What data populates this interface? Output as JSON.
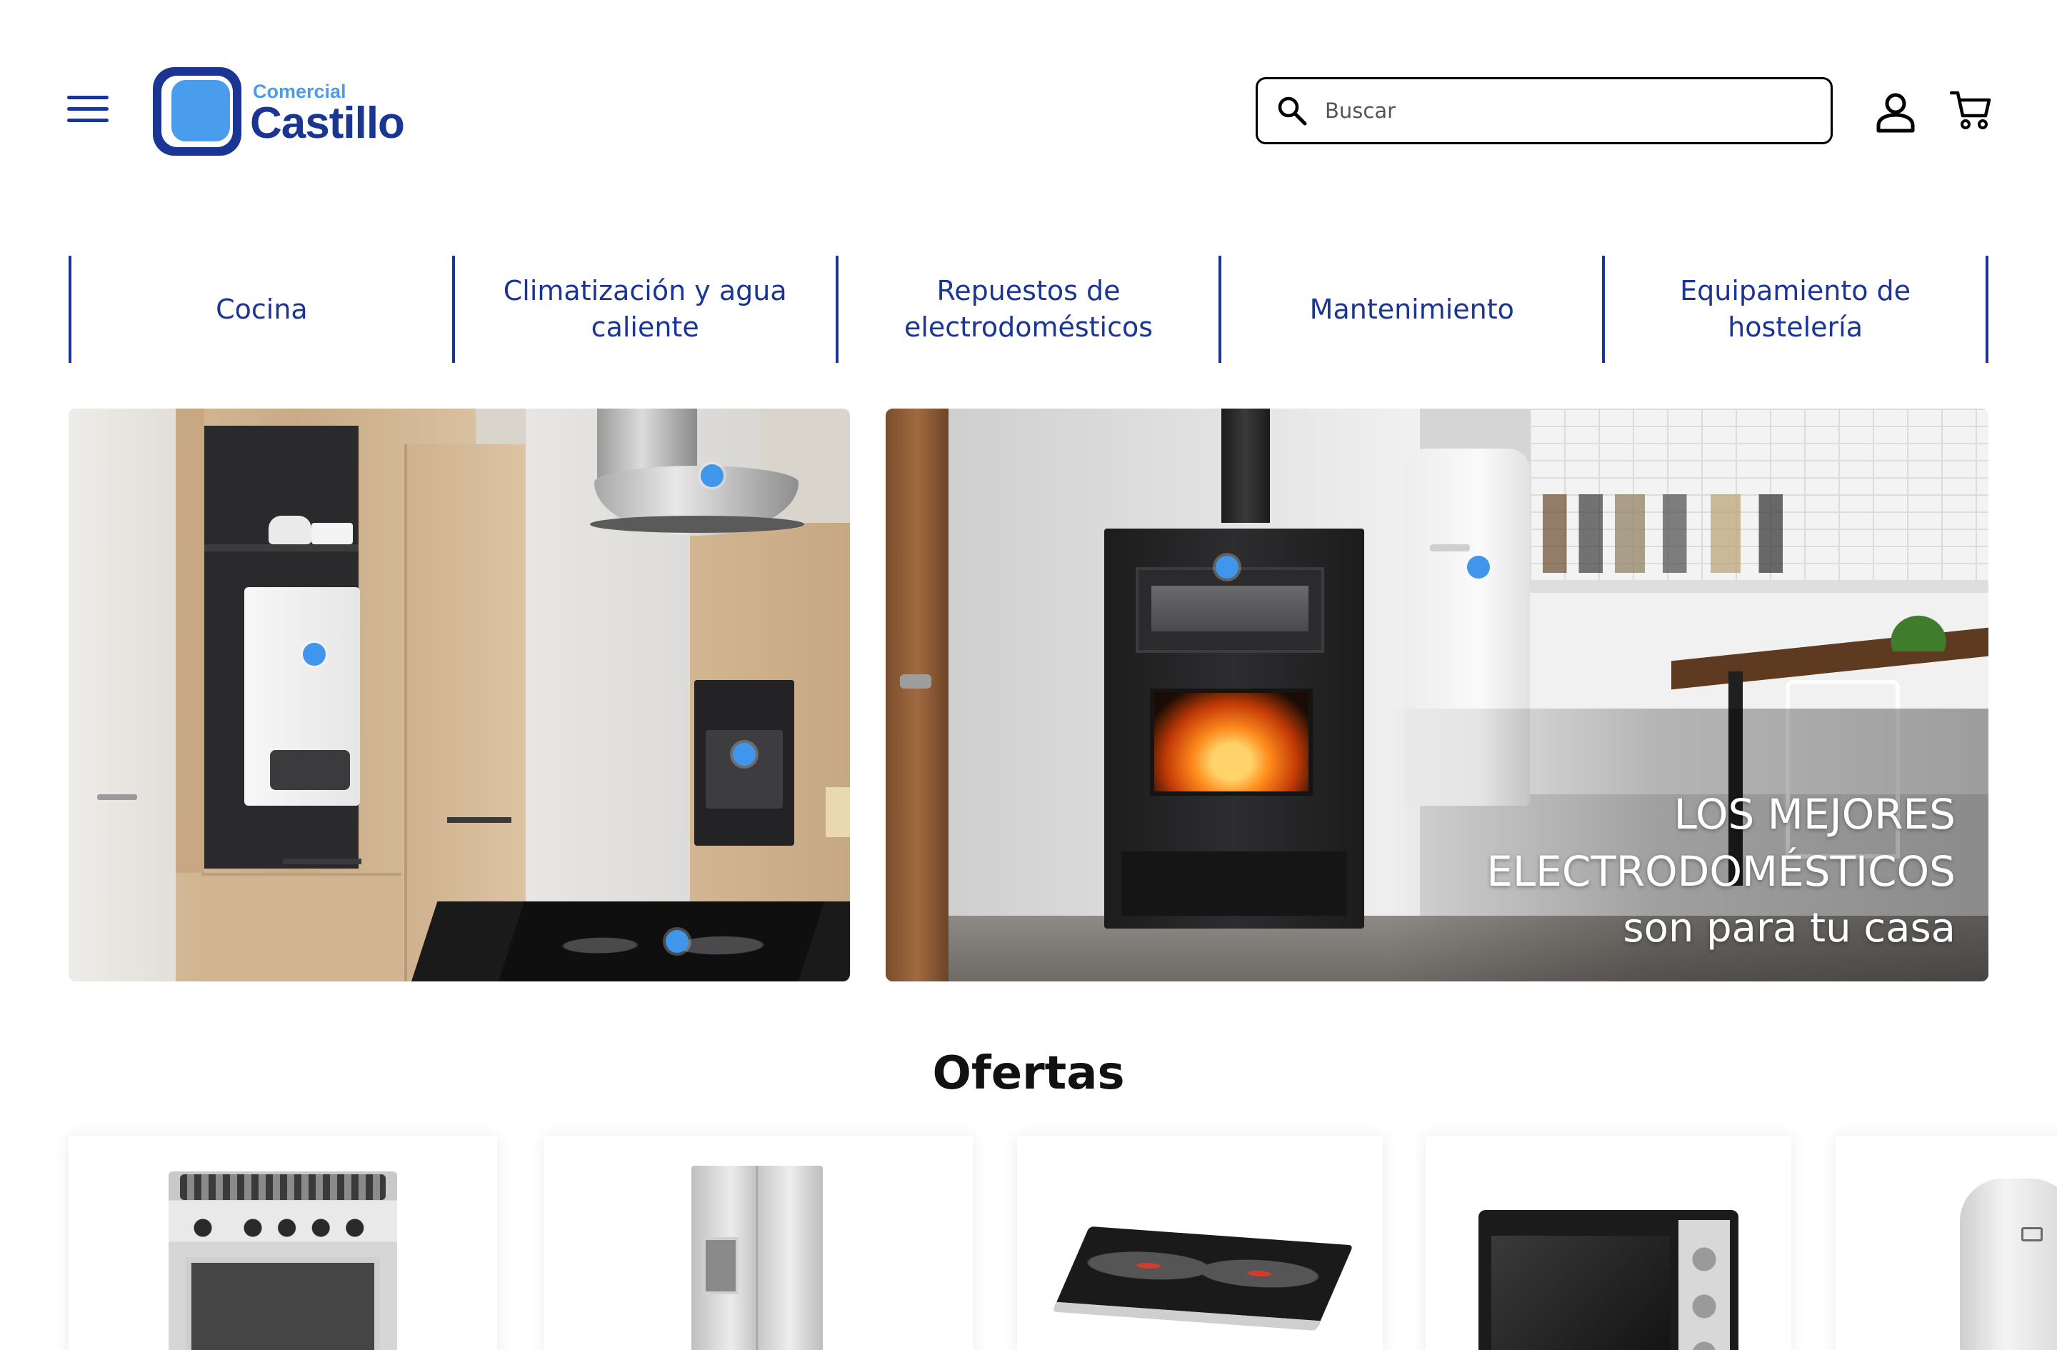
{
  "header": {
    "logo": {
      "small": "Comercial",
      "big": "Castillo"
    },
    "search": {
      "placeholder": "Buscar",
      "value": ""
    }
  },
  "categories": [
    {
      "label": "Cocina"
    },
    {
      "label": "Climatización y agua caliente"
    },
    {
      "label": "Repuestos de electrodomésticos"
    },
    {
      "label": "Mantenimiento"
    },
    {
      "label": "Equipamiento de hostelería"
    }
  ],
  "hero": {
    "line1": "LOS MEJORES",
    "line2": "ELECTRODOMÉSTICOS",
    "line3": "son para tu casa"
  },
  "offers": {
    "title": "Ofertas",
    "products": [
      {
        "image": "gas-range-cooker"
      },
      {
        "image": "side-by-side-refrigerator"
      },
      {
        "image": "double-induction-hob"
      },
      {
        "image": "electric-mini-oven"
      },
      {
        "image": "electric-water-heater"
      }
    ]
  },
  "colors": {
    "brand_blue": "#1a3594",
    "accent_blue": "#4a9ded",
    "hotspot": "#3f96ea"
  }
}
